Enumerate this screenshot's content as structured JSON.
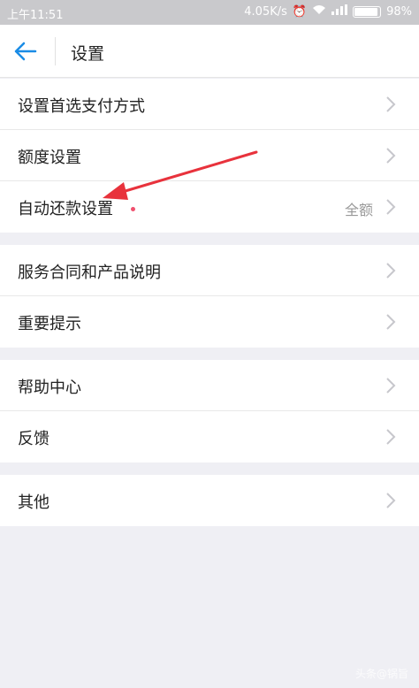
{
  "status_bar": {
    "time": "上午11:51",
    "speed": "4.05K/s",
    "battery": "98%"
  },
  "header": {
    "title": "设置"
  },
  "groups": [
    {
      "items": [
        {
          "label": "设置首选支付方式"
        },
        {
          "label": "额度设置"
        },
        {
          "label": "自动还款设置",
          "value": "全额",
          "has_dot": true
        }
      ]
    },
    {
      "items": [
        {
          "label": "服务合同和产品说明"
        },
        {
          "label": "重要提示"
        }
      ]
    },
    {
      "items": [
        {
          "label": "帮助中心"
        },
        {
          "label": "反馈"
        }
      ]
    },
    {
      "items": [
        {
          "label": "其他"
        }
      ]
    }
  ],
  "watermark": "头条@锅旨",
  "colors": {
    "accent": "#1a8ce6",
    "annotation_arrow": "#e8323c",
    "dot": "#f0506e"
  }
}
